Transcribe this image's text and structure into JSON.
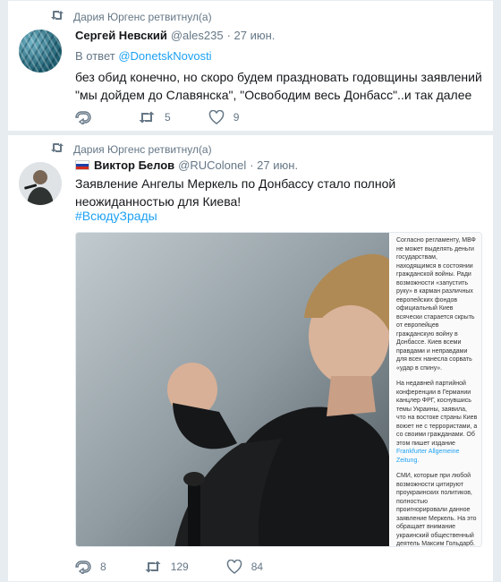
{
  "tweets": [
    {
      "retweet_text": "Дария Юргенс ретвитнул(а)",
      "name": "Сергей Невский",
      "handle": "@ales235",
      "time": "· 27 июн.",
      "reply_prefix": "В ответ",
      "reply_to": "@DonetskNovosti",
      "text": "без обид конечно, но скоро будем праздновать годовщины заявлений \"мы дойдем до Славянска\", \"Освободим весь Донбасс\"..и так далее",
      "retweets": "5",
      "likes": "9"
    },
    {
      "retweet_text": "Дария Юргенс ретвитнул(а)",
      "name": "Виктор Белов",
      "handle": "@RUColonel",
      "time": "· 27 июн.",
      "text": "Заявление Ангелы Меркель по Донбассу стало полной неожиданностью для Киева!",
      "hashtag": "#ВсюдуЗрады",
      "replies": "8",
      "retweets": "129",
      "likes": "84",
      "side_text": {
        "p1": "Согласно регламенту, МВФ не может выделять деньги государствам, находящимся в состоянии гражданской войны. Ради возможности «запустить руку» в карман различных европейских фондов официальный Киев всячески старается скрыть от европейцев гражданскую войну в Донбассе. Киев всеми правдами и неправдами для всех нанесла сорвать «удар в спину».",
        "p2_start": "На недавней партийной конференции в Германии канцлер ФРГ, коснувшись темы Украины, заявила, что на востоке страны Киев воюет не с террористами, а со своими гражданами. Об этом пишет издание",
        "p2_link": "Frankfurter Allgemeine Zeitung.",
        "p3": "СМИ, которые при любой возможности цитируют проукраинских политиков, полностью проигнорировали данное заявление Меркель. На это обращает внимание украинский общественный деятель Максим Гольдарб. Он задался вопросом, почему украинские политики не стали «клеймить» Меркель за её «оговорку», как «Меркель»..."
      }
    }
  ],
  "colors": {
    "link": "#1da1f2",
    "muted": "#657786",
    "text": "#14171a"
  }
}
